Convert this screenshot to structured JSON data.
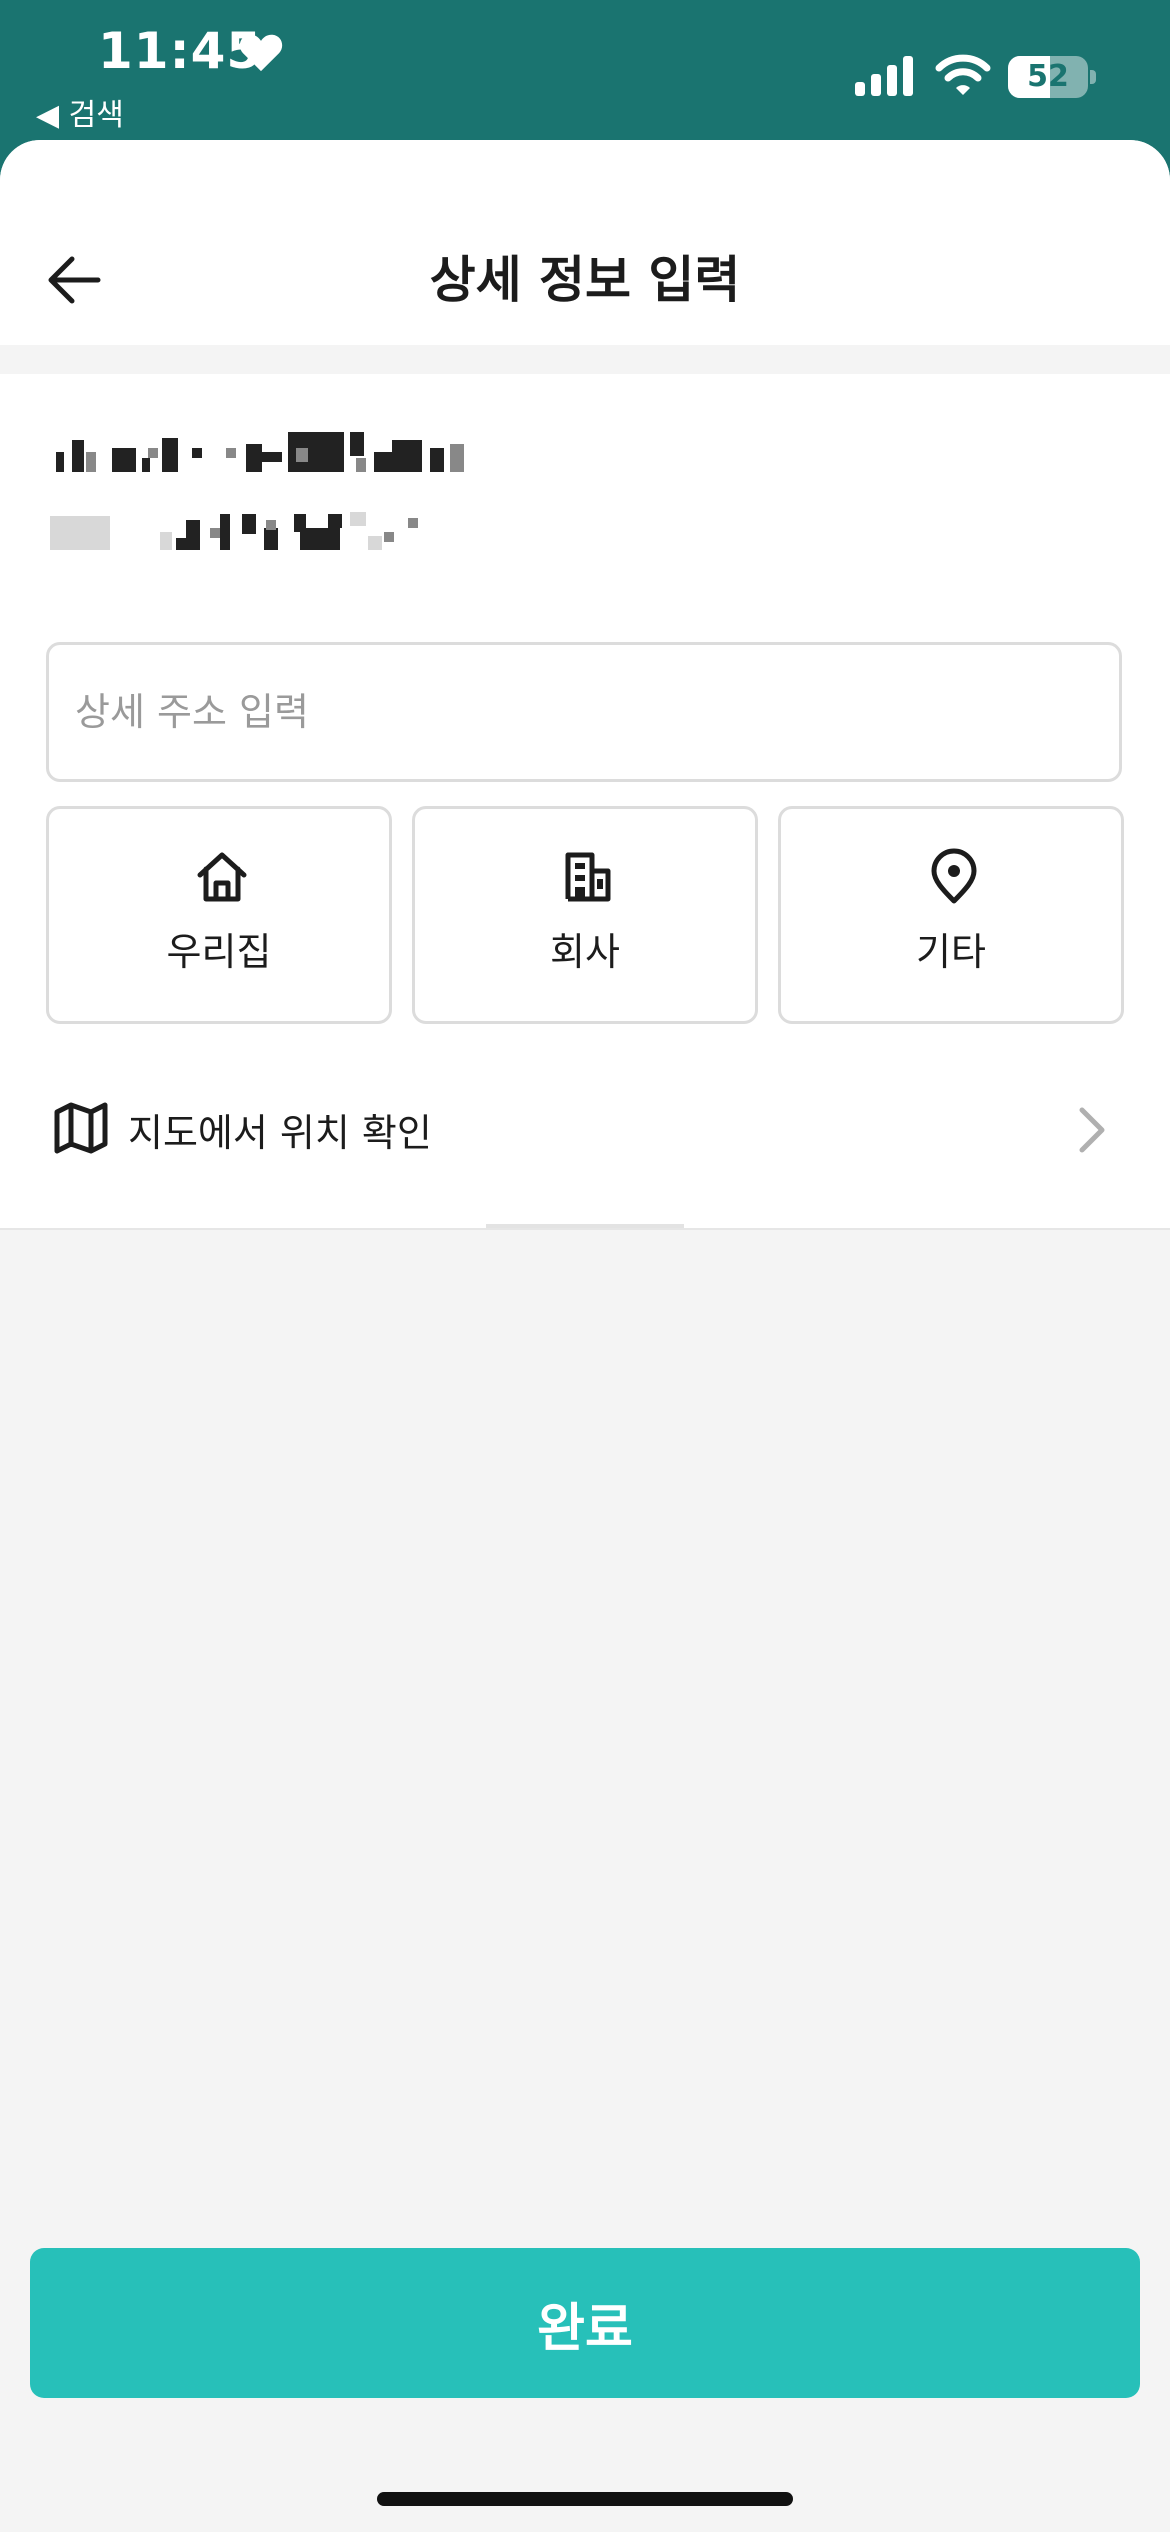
{
  "status_bar": {
    "time": "11:45",
    "back_app_label": "◀ 검색",
    "battery": "52"
  },
  "header": {
    "title": "상세 정보 입력"
  },
  "address": {
    "detail_placeholder": "상세 주소 입력"
  },
  "place_types": [
    {
      "label": "우리집",
      "icon": "home-icon"
    },
    {
      "label": "회사",
      "icon": "building-icon"
    },
    {
      "label": "기타",
      "icon": "location-pin-icon"
    }
  ],
  "map_link": {
    "label": "지도에서 위치 확인",
    "icon": "map-icon"
  },
  "footer": {
    "done_label": "완료"
  },
  "colors": {
    "status_bar": "#1a7470",
    "accent": "#27c0b9"
  }
}
